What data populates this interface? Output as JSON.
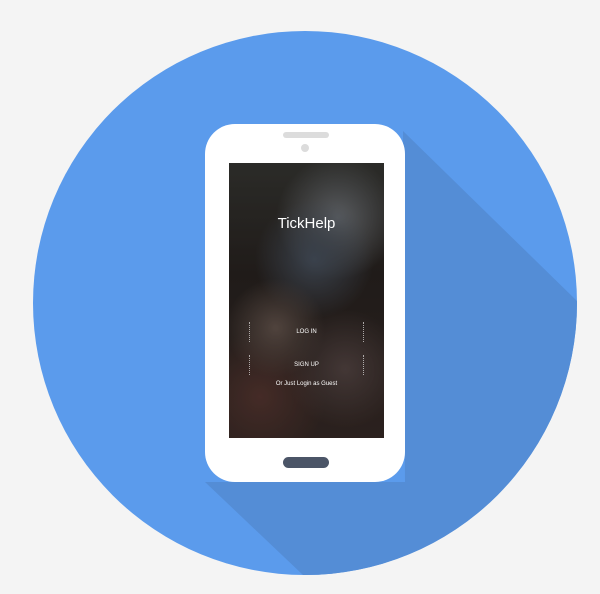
{
  "app": {
    "title": "TickHelp",
    "login_label": "LOG IN",
    "signup_label": "SIGN UP",
    "guest_label": "Or Just Login as Guest"
  },
  "colors": {
    "background": "#f4f4f4",
    "circle": "#5b9bec",
    "shadow": "#548dd6",
    "phone": "#ffffff",
    "home_button": "#4b5567"
  },
  "icons": [
    "phone-illustration",
    "speaker-icon",
    "camera-icon",
    "home-button-icon"
  ]
}
